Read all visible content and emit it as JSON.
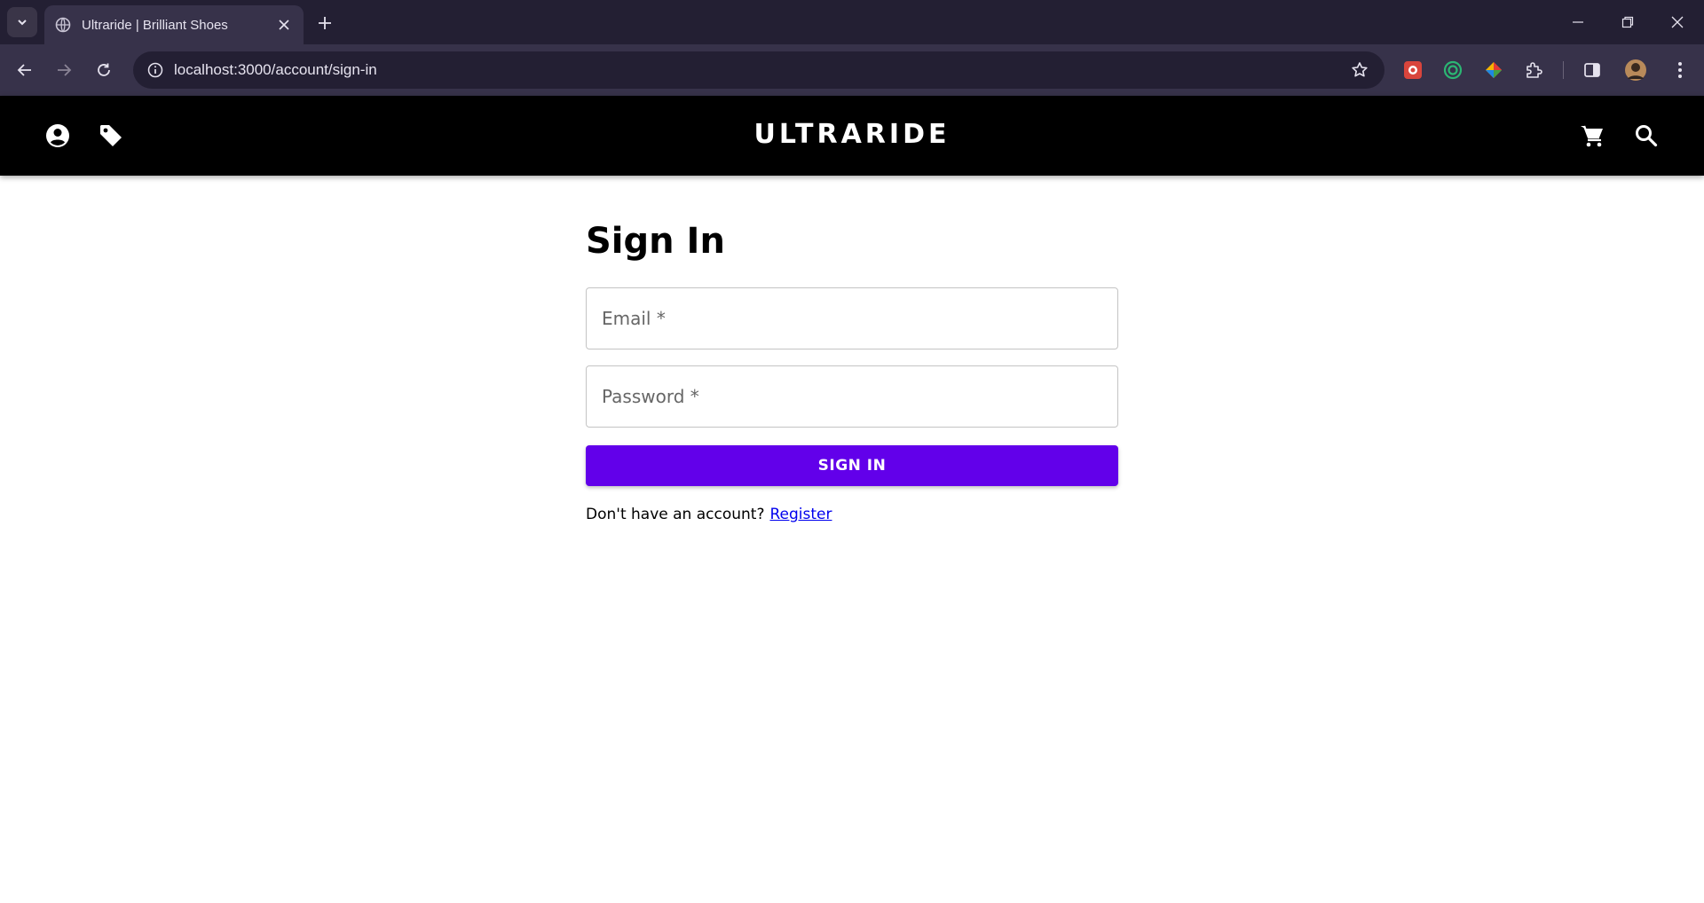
{
  "browser": {
    "tab_title": "Ultraride | Brilliant Shoes",
    "url": "localhost:3000/account/sign-in"
  },
  "site": {
    "brand": "ULTRARIDE",
    "header_icons": [
      "account-icon",
      "tag-icon",
      "cart-icon",
      "search-icon"
    ]
  },
  "signin": {
    "title": "Sign In",
    "email_label": "Email *",
    "password_label": "Password *",
    "button_label": "SIGN IN",
    "register_prompt": "Don't have an account?",
    "register_link": "Register"
  },
  "colors": {
    "primary": "#6200ea",
    "header_bg": "#000000",
    "link": "#0000ee"
  }
}
